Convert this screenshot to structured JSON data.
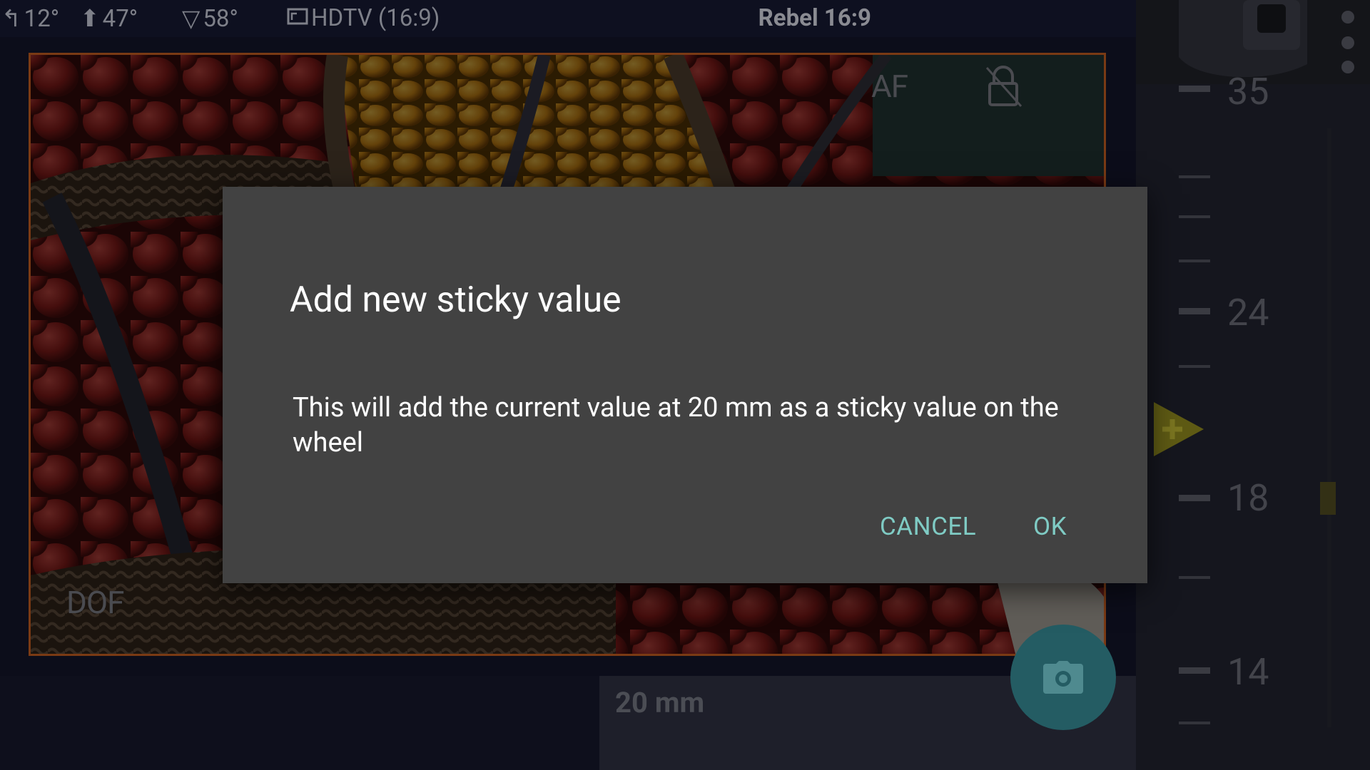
{
  "status_bar": {
    "tilt_value": "12°",
    "elevation_value": "47°",
    "fov_value": "58°",
    "format_value": "HDTV (16:9)",
    "camera_model": "Rebel 16:9"
  },
  "viewfinder": {
    "af_label": "AF",
    "dof_label": "DOF"
  },
  "focal_readout": "20 mm",
  "wheel": {
    "labels": [
      "35",
      "24",
      "18",
      "14"
    ]
  },
  "dialog": {
    "title": "Add new sticky value",
    "message": "This will add the current value at 20 mm as a sticky value on the wheel",
    "cancel_label": "CANCEL",
    "ok_label": "OK"
  },
  "colors": {
    "accent": "#7fcbc4",
    "dialog_bg": "#424242",
    "fab": "#245c63",
    "pointer": "#5e5a14"
  }
}
